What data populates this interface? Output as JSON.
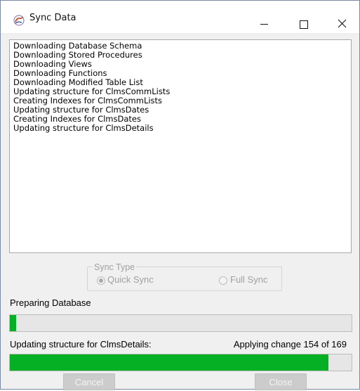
{
  "window": {
    "title": "Sync Data",
    "app_icon": "sync-app-icon",
    "controls": [
      "minimize-icon",
      "maximize-icon",
      "close-icon"
    ]
  },
  "log": {
    "lines": [
      "Downloading Database Schema",
      "Downloading Stored Procedures",
      "Downloading Views",
      "Downloading Functions",
      "Downloading Modified Table List",
      "Updating structure for ClmsCommLists",
      "Creating Indexes for ClmsCommLists",
      "Updating structure for ClmsDates",
      "Creating Indexes for ClmsDates",
      "Updating structure for ClmsDetails"
    ]
  },
  "sync_type": {
    "legend": "Sync Type",
    "options": [
      {
        "label": "Quick Sync",
        "checked": true
      },
      {
        "label": "Full Sync",
        "checked": false
      }
    ]
  },
  "status": {
    "preparing_label": "Preparing Database",
    "db_progress": 0.018,
    "detail_label": "Updating structure for ClmsDetails:",
    "change_label": "Applying change 154 of 169",
    "change_progress": 0.932
  },
  "buttons": {
    "cancel": "Cancel",
    "close": "Close"
  },
  "colors": {
    "progress_fill": "#06b025",
    "disabled_text": "#a0a0a0",
    "disabled_button": "#cccccc"
  }
}
